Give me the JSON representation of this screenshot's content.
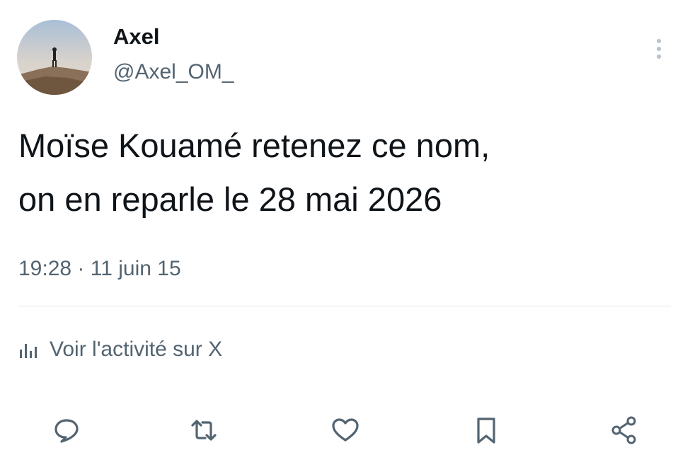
{
  "user": {
    "name": "Axel",
    "handle": "@Axel_OM_",
    "avatar_icon": "profile-photo"
  },
  "tweet": {
    "text": "Moïse Kouamé retenez ce nom,\non en reparle le 28 mai 2026",
    "time": "19:28",
    "date": "11 juin 15"
  },
  "activity": {
    "label": "Voir l'activité sur X",
    "icon": "analytics-icon"
  },
  "actions": [
    {
      "name": "reply",
      "icon": "reply-icon"
    },
    {
      "name": "retweet",
      "icon": "retweet-icon"
    },
    {
      "name": "like",
      "icon": "heart-icon"
    },
    {
      "name": "bookmark",
      "icon": "bookmark-icon"
    },
    {
      "name": "share",
      "icon": "share-icon"
    }
  ],
  "colors": {
    "text_primary": "#0f1419",
    "text_secondary": "#536471",
    "icon": "#536471",
    "divider": "#e1e6ea"
  }
}
